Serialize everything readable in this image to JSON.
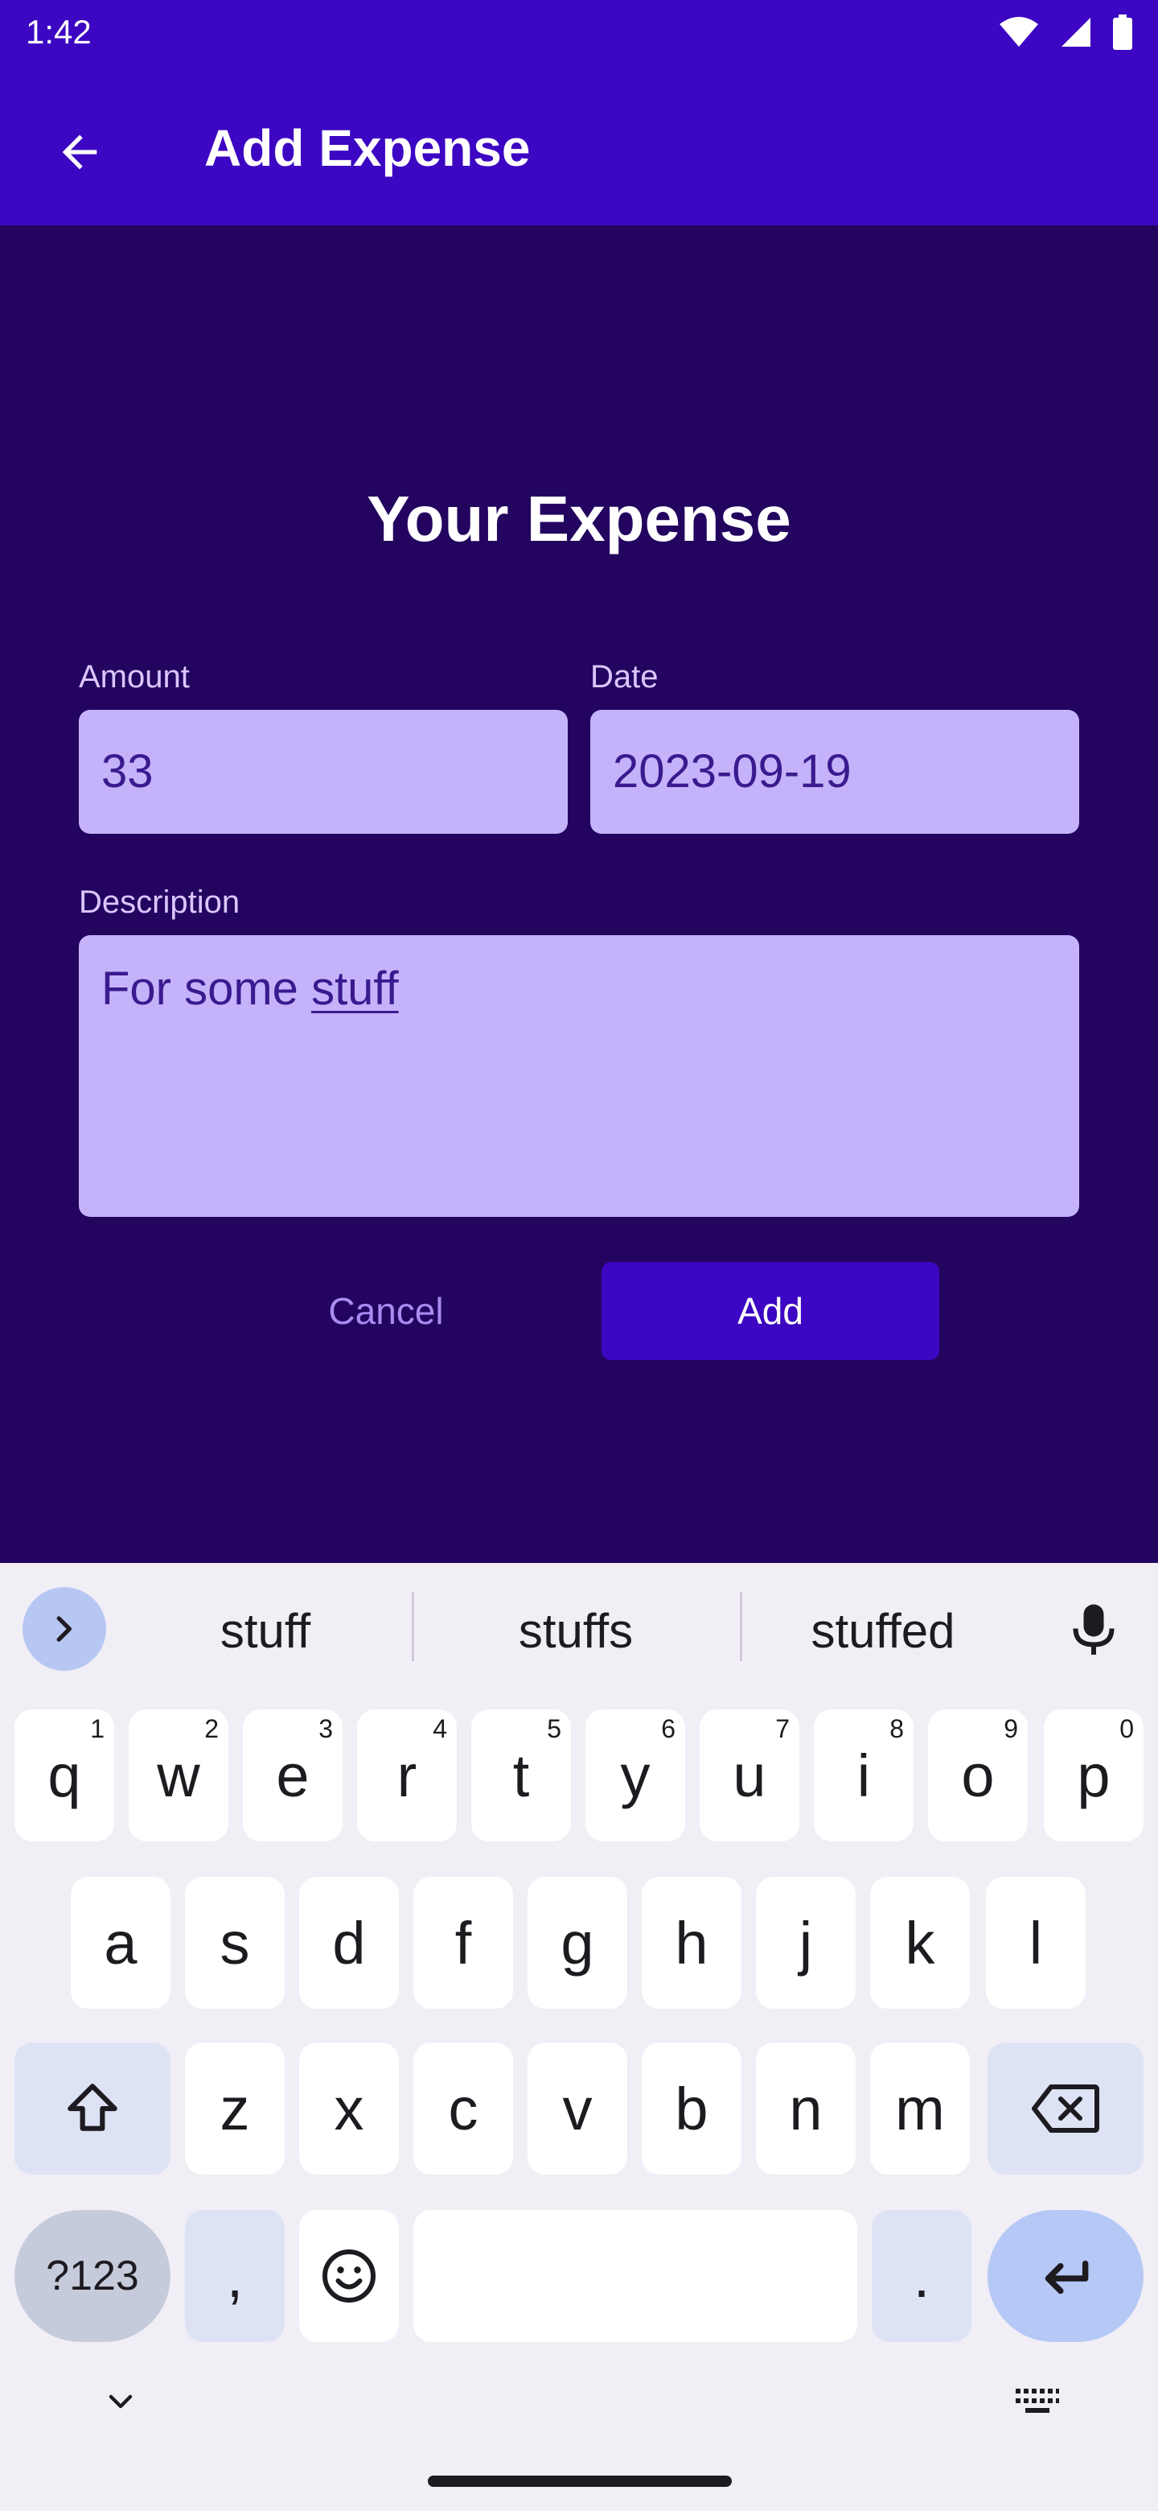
{
  "status_bar": {
    "time": "1:42",
    "icons": [
      "wifi-icon",
      "cellular-signal-icon",
      "battery-icon"
    ]
  },
  "app_bar": {
    "title": "Add Expense",
    "back_icon": "arrow-back-icon"
  },
  "form": {
    "title": "Your Expense",
    "amount": {
      "label": "Amount",
      "value": "33"
    },
    "date": {
      "label": "Date",
      "value": "2023-09-19"
    },
    "description": {
      "label": "Description",
      "value_prefix": "For some ",
      "value_word": "stuff"
    },
    "cancel_label": "Cancel",
    "add_label": "Add"
  },
  "keyboard": {
    "suggestions": [
      "stuff",
      "stuffs",
      "stuffed"
    ],
    "row1": [
      {
        "key": "q",
        "hint": "1"
      },
      {
        "key": "w",
        "hint": "2"
      },
      {
        "key": "e",
        "hint": "3"
      },
      {
        "key": "r",
        "hint": "4"
      },
      {
        "key": "t",
        "hint": "5"
      },
      {
        "key": "y",
        "hint": "6"
      },
      {
        "key": "u",
        "hint": "7"
      },
      {
        "key": "i",
        "hint": "8"
      },
      {
        "key": "o",
        "hint": "9"
      },
      {
        "key": "p",
        "hint": "0"
      }
    ],
    "row2": [
      "a",
      "s",
      "d",
      "f",
      "g",
      "h",
      "j",
      "k",
      "l"
    ],
    "row3": [
      "z",
      "x",
      "c",
      "v",
      "b",
      "n",
      "m"
    ],
    "symbols_label": "?123",
    "comma_label": ",",
    "period_label": "."
  },
  "colors": {
    "app_bar": "#3c06c2",
    "background": "#23045f",
    "field": "#c4b3fa",
    "field_text": "#3a1a8f",
    "keyboard": "#f1eef6"
  }
}
